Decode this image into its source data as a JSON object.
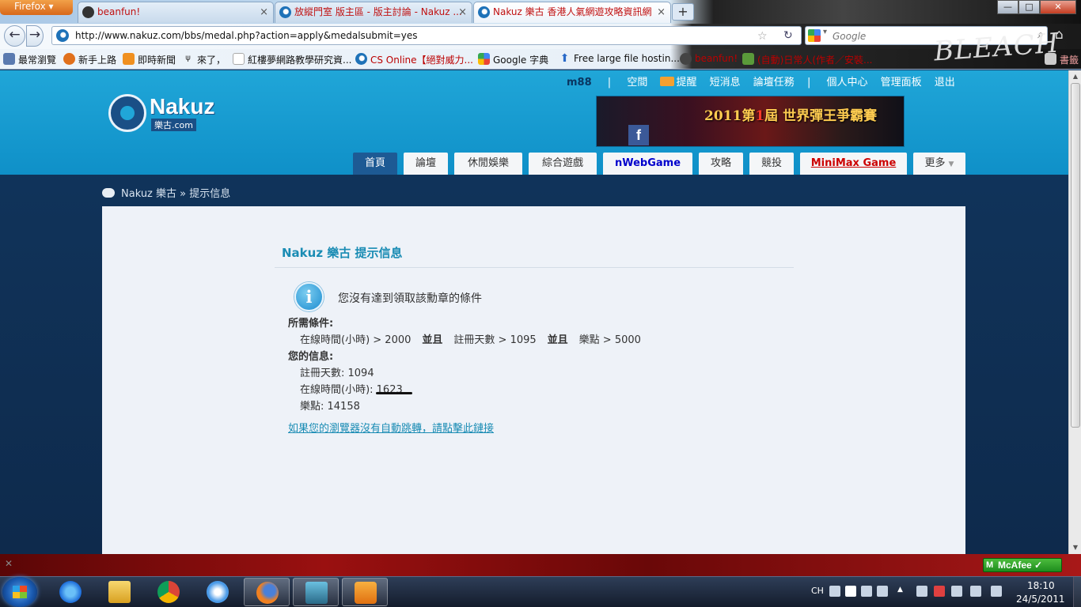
{
  "browser": {
    "menu_label": "Firefox",
    "tabs": [
      {
        "title": "beanfun!",
        "close": "×",
        "style": "red",
        "active": false
      },
      {
        "title": "放縱門室 版主區 - 版主討論 - Nakuz ...",
        "close": "×",
        "style": "red",
        "active": false
      },
      {
        "title": "Nakuz 樂古 香港人氣網遊攻略資訊網",
        "close": "×",
        "style": "red",
        "active": true
      }
    ],
    "new_tab": "+",
    "window_controls": {
      "minimize": "—",
      "maximize": "□",
      "close": "✕"
    },
    "back": "←",
    "forward": "→",
    "url": "http://www.nakuz.com/bbs/medal.php?action=apply&medalsubmit=yes",
    "star": "☆",
    "reload": "↻",
    "search_placeholder": "Google",
    "search_go": "⌕",
    "home": "⌂",
    "bookmarks": [
      {
        "label": "最常瀏覽",
        "icon": "mag-icon",
        "color": "#5a7ab0"
      },
      {
        "label": "新手上路",
        "icon": "firefox-icon",
        "color": "#e0701c"
      },
      {
        "label": "即時新聞",
        "icon": "rss-icon",
        "color": "#f09020"
      },
      {
        "label": "來了，",
        "icon": "stick-icon",
        "color": "#333"
      },
      {
        "label": "紅樓夢網路教學研究資...",
        "icon": "page-icon",
        "color": "#aaa"
      },
      {
        "label": "CS Online【絕對威力...",
        "icon": "nakuz-icon",
        "color": "#1e72b8",
        "red": true
      },
      {
        "label": "Google 字典",
        "icon": "google-icon",
        "color": "#4285f4"
      },
      {
        "label": "Free large file hostin...",
        "icon": "arrow-icon",
        "color": "#2a6ac8"
      },
      {
        "label": "beanfun!",
        "icon": "beanfun-icon",
        "color": "#444",
        "red": true
      },
      {
        "label": "(自動)日常人(作者／安裝...",
        "icon": "leaf-icon",
        "color": "#5a9a3a",
        "red": true
      }
    ],
    "bookmarks_overflow": "書籤",
    "theme_art_text": "BLEACH"
  },
  "site": {
    "logo_text": "Nakuz",
    "logo_sub": "樂古.com",
    "top_nav": {
      "user": "m88",
      "sep": "|",
      "space": "空間",
      "remind": "提醒",
      "pm": "短消息",
      "tasks": "論壇任務",
      "sep2": "|",
      "user_center": "個人中心",
      "admin": "管理面板",
      "logout": "退出"
    },
    "ad": {
      "line1": "2011第",
      "num": "1",
      "line2": "屆 世界彈王爭霸賽",
      "fb": "f"
    },
    "main_nav": [
      {
        "label": "首頁",
        "style": "active"
      },
      {
        "label": "論壇",
        "style": ""
      },
      {
        "label": "休閒娛樂",
        "style": ""
      },
      {
        "label": "綜合遊戲",
        "style": ""
      },
      {
        "label": "nWebGame",
        "style": "blue"
      },
      {
        "label": "攻略",
        "style": ""
      },
      {
        "label": "競投",
        "style": ""
      },
      {
        "label": "MiniMax Game",
        "style": "red"
      },
      {
        "label": "更多",
        "style": "more"
      }
    ],
    "breadcrumb": "Nakuz 樂古 » 提示信息",
    "message": {
      "title": "Nakuz 樂古 提示信息",
      "main": "您沒有達到領取該勳章的條件",
      "req_label": "所需條件:",
      "req_line": {
        "online": "在線時間(小時) > 2000",
        "and1": "並且",
        "days": "註冊天數 > 1095",
        "and2": "並且",
        "points": "樂點 > 5000"
      },
      "your_label": "您的信息:",
      "your_days": "註冊天數: 1094",
      "your_online_label": "在線時間(小時): ",
      "your_online_value": "1623",
      "your_points": "樂點: 14158",
      "redirect": "如果您的瀏覽器沒有自動跳轉，請點擊此鏈接",
      "info_glyph": "i"
    }
  },
  "addon": {
    "close": "✕",
    "mcafee": "McAfee"
  },
  "taskbar": {
    "lang": "CH",
    "time": "18:10",
    "date": "24/5/2011"
  }
}
